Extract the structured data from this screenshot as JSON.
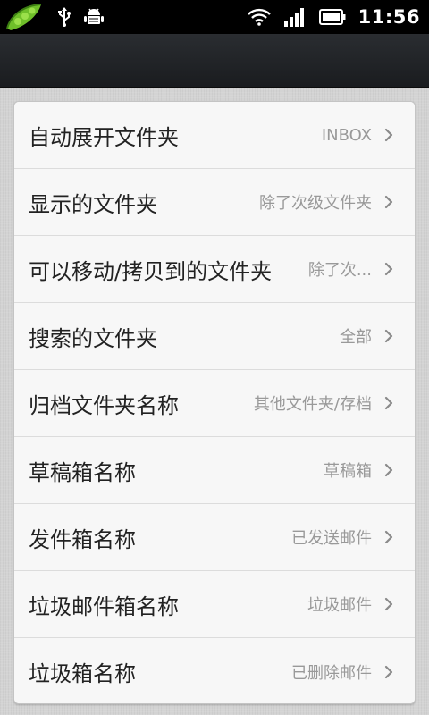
{
  "status_bar": {
    "time": "11:56",
    "icons": [
      "app-pea-icon",
      "usb-icon",
      "android-debug-icon",
      "wifi-icon",
      "signal-icon",
      "battery-icon"
    ]
  },
  "settings": {
    "items": [
      {
        "label": "自动展开文件夹",
        "value": "INBOX"
      },
      {
        "label": "显示的文件夹",
        "value": "除了次级文件夹"
      },
      {
        "label": "可以移动/拷贝到的文件夹",
        "value": "除了次..."
      },
      {
        "label": "搜索的文件夹",
        "value": "全部"
      },
      {
        "label": "归档文件夹名称",
        "value": "其他文件夹/存档"
      },
      {
        "label": "草稿箱名称",
        "value": "草稿箱"
      },
      {
        "label": "发件箱名称",
        "value": "已发送邮件"
      },
      {
        "label": "垃圾邮件箱名称",
        "value": "垃圾邮件"
      },
      {
        "label": "垃圾箱名称",
        "value": "已删除邮件"
      }
    ]
  }
}
